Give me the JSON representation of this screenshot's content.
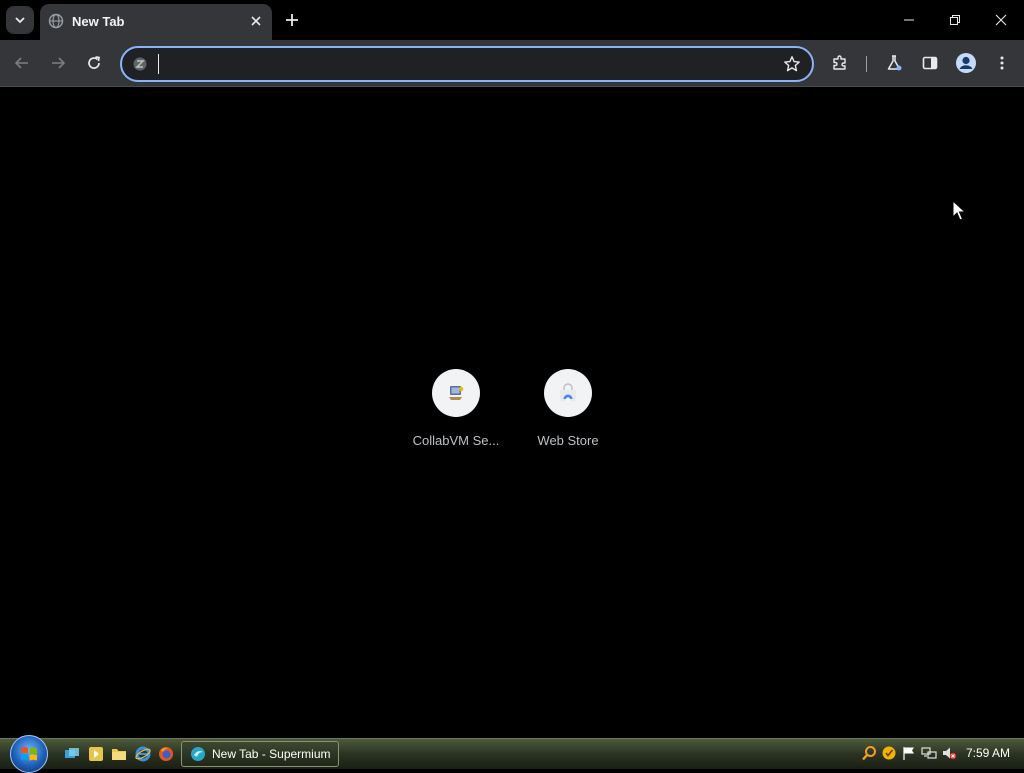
{
  "browser": {
    "tab": {
      "title": "New Tab"
    },
    "omnibox": {
      "value": "",
      "placeholder": ""
    },
    "accent": "#8ab4f8"
  },
  "ntp": {
    "shortcuts": [
      {
        "label": "CollabVM Se...",
        "icon": "collabvm-icon"
      },
      {
        "label": "Web Store",
        "icon": "web-store-icon"
      }
    ]
  },
  "taskbar": {
    "task_label": "New Tab - Supermium",
    "clock": "7:59 AM",
    "quick_launch": [
      "switch-windows-icon",
      "media-player-icon",
      "folder-icon",
      "internet-explorer-icon",
      "firefox-icon"
    ],
    "tray": [
      "search-icon",
      "norton-icon",
      "flag-icon",
      "network-icon",
      "volume-muted-icon"
    ]
  }
}
